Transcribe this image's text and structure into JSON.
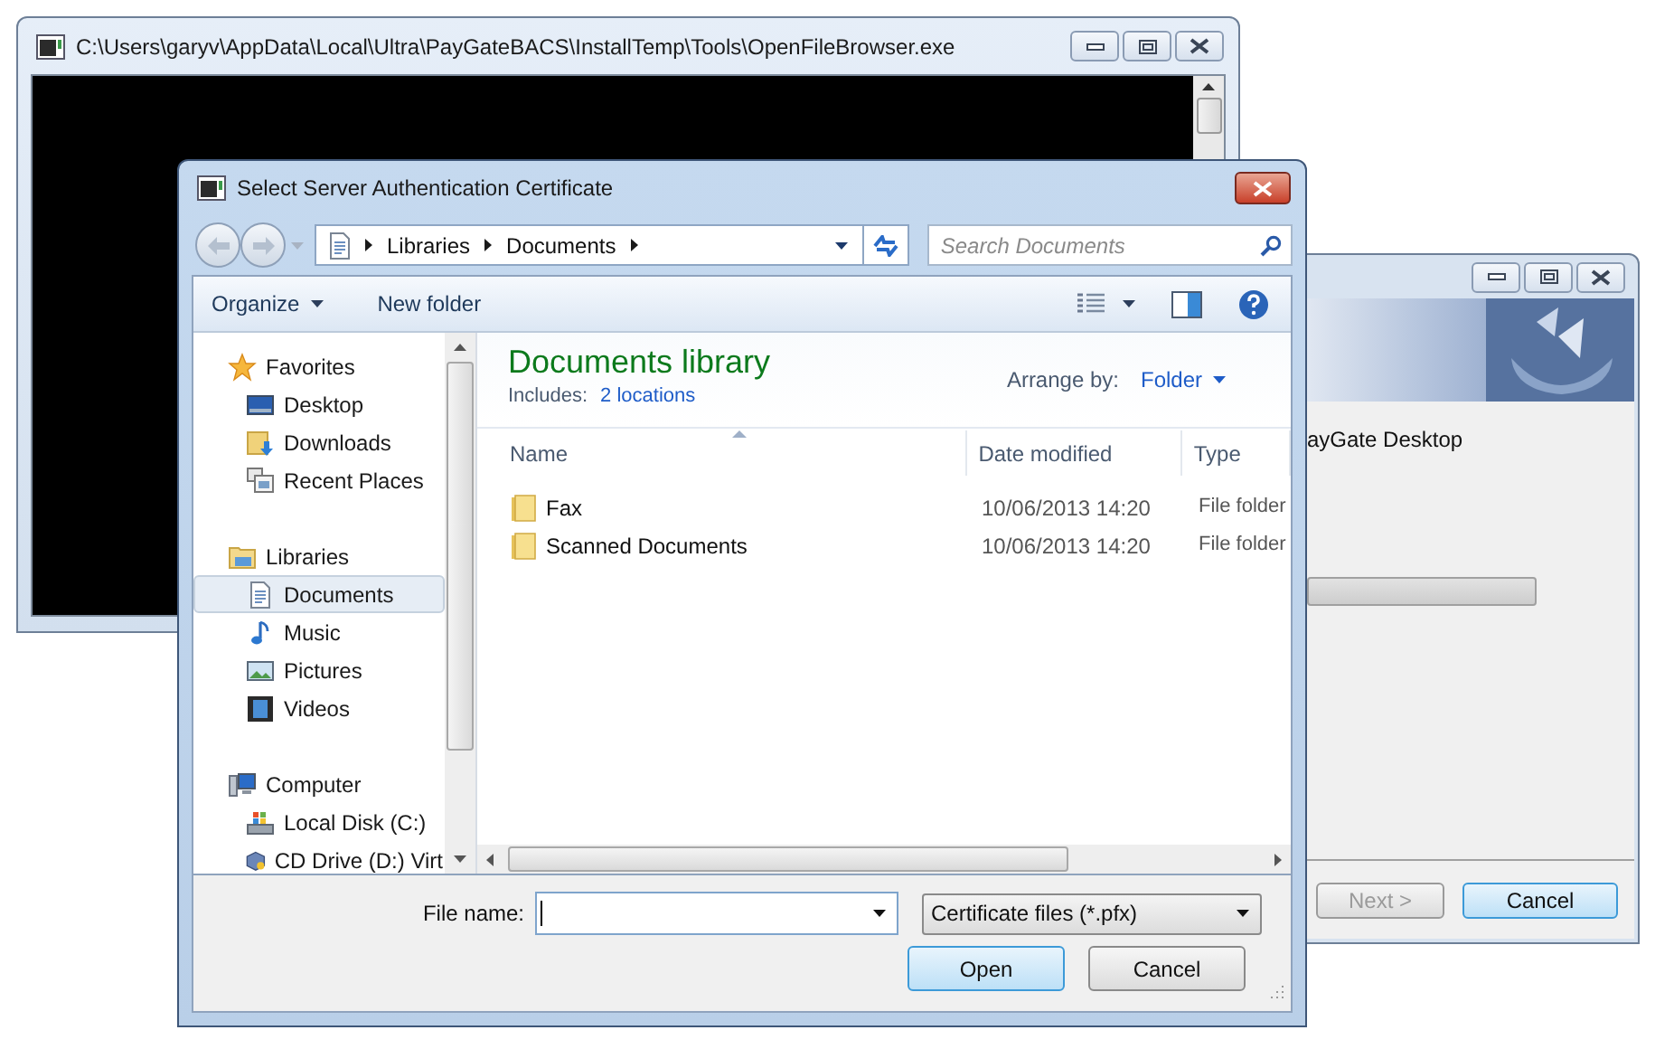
{
  "console_window": {
    "title": "C:\\Users\\garyv\\AppData\\Local\\Ultra\\PayGateBACS\\InstallTemp\\Tools\\OpenFileBrowser.exe"
  },
  "installer_window": {
    "text": "ayGate Desktop",
    "progress": {
      "level": 0
    },
    "buttons": [
      {
        "label": "Next >",
        "disabled": true,
        "default": false
      },
      {
        "label": "Cancel",
        "disabled": false,
        "default": true
      }
    ]
  },
  "dialog": {
    "title": "Select Server Authentication Certificate",
    "address": {
      "crumbs": [
        "Libraries",
        "Documents"
      ]
    },
    "search": {
      "placeholder": "Search Documents"
    },
    "toolbar": [
      {
        "label": "Organize",
        "dropdown": true
      },
      {
        "label": "New folder",
        "dropdown": false
      }
    ],
    "sidebar": {
      "items": [
        {
          "label": "Favorites",
          "kind": "star",
          "selected": false,
          "children": [
            {
              "label": "Desktop",
              "kind": "desktop",
              "selected": false
            },
            {
              "label": "Downloads",
              "kind": "downloads",
              "selected": false
            },
            {
              "label": "Recent Places",
              "kind": "recent",
              "selected": false
            }
          ]
        },
        {
          "label": "Libraries",
          "kind": "library",
          "selected": false,
          "children": [
            {
              "label": "Documents",
              "kind": "documents",
              "selected": true
            },
            {
              "label": "Music",
              "kind": "music",
              "selected": false
            },
            {
              "label": "Pictures",
              "kind": "pictures",
              "selected": false
            },
            {
              "label": "Videos",
              "kind": "videos",
              "selected": false
            }
          ]
        },
        {
          "label": "Computer",
          "kind": "computer",
          "selected": false,
          "children": [
            {
              "label": "Local Disk (C:)",
              "kind": "disk",
              "selected": false
            },
            {
              "label": "CD Drive (D:) Virt",
              "kind": "cd",
              "selected": false
            }
          ]
        }
      ]
    },
    "library": {
      "title": "Documents library",
      "includes_label": "Includes:",
      "includes_link": "2 locations",
      "arrange_label": "Arrange by:",
      "arrange_value": "Folder"
    },
    "table": {
      "columns": [
        {
          "label": "Name",
          "sorted": true
        },
        {
          "label": "Date modified",
          "sorted": false
        },
        {
          "label": "Type",
          "sorted": false
        }
      ],
      "rows": [
        {
          "name": "Fax",
          "date_modified": "10/06/2013 14:20",
          "type": "File folder"
        },
        {
          "name": "Scanned Documents",
          "date_modified": "10/06/2013 14:20",
          "type": "File folder"
        }
      ]
    },
    "file_name": {
      "label": "File name:"
    },
    "filter": "Certificate files (*.pfx)",
    "buttons": [
      {
        "label": "Open",
        "default": true
      },
      {
        "label": "Cancel",
        "default": false
      }
    ]
  }
}
